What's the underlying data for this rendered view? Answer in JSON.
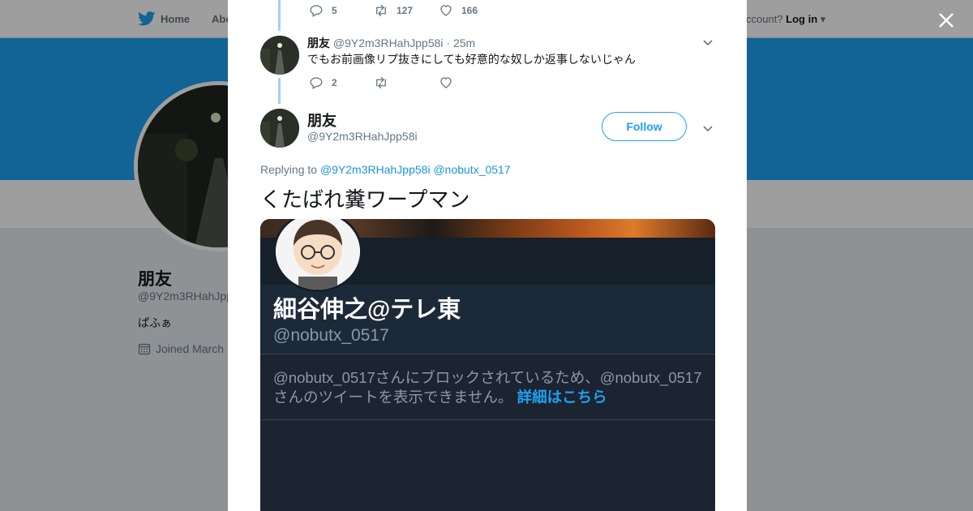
{
  "topbar": {
    "home_label": "Home",
    "about_label": "Abo",
    "account_prompt": "ccount?",
    "login_label": "Log in"
  },
  "profile": {
    "name": "朋友",
    "handle": "@9Y2m3RHahJpp",
    "bio": "ぱふぁ",
    "joined": "Joined March"
  },
  "thread": {
    "prev_tweet_actions": {
      "replies": "5",
      "retweets": "127",
      "likes": "166"
    },
    "reply": {
      "name": "朋友",
      "handle": "@9Y2m3RHahJpp58i",
      "separator": "·",
      "time": "25m",
      "text": "でもお前画像リプ抜きにしても好意的な奴しか返事しないじゃん",
      "actions": {
        "replies": "2",
        "retweets": "",
        "likes": ""
      }
    },
    "main": {
      "name": "朋友",
      "handle": "@9Y2m3RHahJpp58i",
      "follow_label": "Follow",
      "replying_prefix": "Replying to",
      "replying_to": [
        "@9Y2m3RHahJpp58i",
        "@nobutx_0517"
      ],
      "text": "くたばれ糞ワープマン",
      "media": {
        "screen_name": "細谷伸之@テレ東",
        "screen_handle": "@nobutx_0517",
        "blocked_message": "@nobutx_0517さんにブロックされているため、@nobutx_0517さんのツイートを表示できません。",
        "link_text": "詳細はこちら"
      }
    }
  },
  "colors": {
    "brand": "#1da1f2",
    "link": "#1b95e0",
    "muted": "#657786",
    "dark_bg": "#15202b"
  },
  "icons": [
    "twitter-bird-icon",
    "close-icon",
    "reply-icon",
    "retweet-icon",
    "like-icon",
    "chevron-down-icon",
    "calendar-icon"
  ]
}
